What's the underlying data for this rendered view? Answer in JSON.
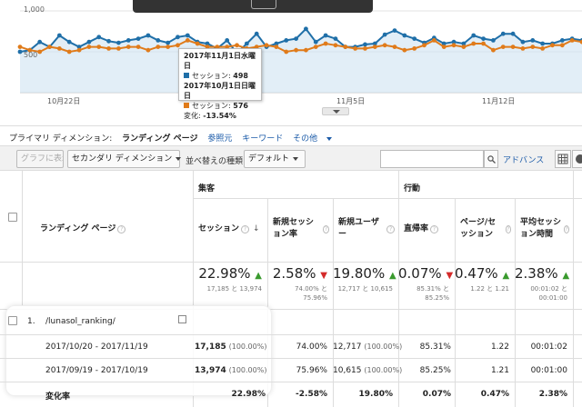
{
  "chart": {
    "y_max_label": "1,000",
    "y_mid_label": "500",
    "x_labels": [
      "10月22日",
      "11月5日",
      "11月12日"
    ],
    "series_colors": {
      "primary": "#1f6fa8",
      "compare": "#e07b1a"
    },
    "tooltip": {
      "date1": "2017年11月1日水曜日",
      "label1": "セッション",
      "value1": "498",
      "date2": "2017年10月1日日曜日",
      "label2": "セッション",
      "value2": "576",
      "change_label": "変化:",
      "change_value": "-13.54%"
    }
  },
  "chart_data": {
    "type": "line",
    "series": [
      {
        "values": [
          500,
          520,
          620,
          560,
          700,
          620,
          560,
          620,
          680,
          630,
          610,
          640,
          660,
          700,
          640,
          610,
          680,
          700,
          620,
          600,
          540,
          640,
          480,
          600,
          720,
          560,
          600,
          640,
          660,
          780,
          620,
          700,
          660,
          560,
          560,
          590,
          600,
          710,
          760,
          700,
          660,
          610,
          670,
          600,
          620,
          600,
          700,
          660,
          640,
          720,
          720,
          620,
          640,
          600,
          600,
          640,
          660,
          640
        ]
      },
      {
        "values": [
          560,
          520,
          500,
          560,
          540,
          500,
          520,
          560,
          560,
          540,
          540,
          560,
          560,
          520,
          560,
          560,
          580,
          640,
          600,
          560,
          560,
          560,
          580,
          540,
          560,
          580,
          560,
          500,
          520,
          520,
          560,
          600,
          580,
          560,
          540,
          540,
          560,
          580,
          560,
          520,
          540,
          580,
          640,
          560,
          580,
          560,
          600,
          600,
          520,
          560,
          560,
          540,
          560,
          540,
          580,
          580,
          640,
          620
        ]
      }
    ],
    "ylim": [
      0,
      1000
    ]
  },
  "dimension_bar": {
    "label": "プライマリ ディメンション:",
    "active": "ランディング ページ",
    "opt1": "参照元",
    "opt2": "キーワード",
    "opt3": "その他"
  },
  "toolbar": {
    "chart_button": "グラフに表示",
    "secondary_dim": "セカンダリ ディメンション",
    "sort_label": "並べ替えの種類:",
    "sort_value": "デフォルト",
    "advanced": "アドバンス"
  },
  "table": {
    "group_acq": "集客",
    "group_behavior": "行動",
    "col_landing": "ランディング ページ",
    "col_sessions": "セッション",
    "col_new_session_rate": "新規セッション率",
    "col_new_users": "新規ユーザー",
    "col_bounce": "直帰率",
    "col_pages": "ページ/セッション",
    "col_duration": "平均セッション時間",
    "summary": {
      "sessions_pct": "22.98%",
      "sessions_sub": "17,185 と 13,974",
      "nsr_pct": "2.58%",
      "nsr_sub1": "74.00% と",
      "nsr_sub2": "75.96%",
      "nu_pct": "19.80%",
      "nu_sub": "12,717 と 10,615",
      "bounce_pct": "0.07%",
      "bounce_sub1": "85.31% と",
      "bounce_sub2": "85.25%",
      "pages_pct": "0.47%",
      "pages_sub": "1.22 と 1.21",
      "dur_pct": "2.38%",
      "dur_sub1": "00:01:02 と",
      "dur_sub2": "00:01:00"
    },
    "row1": {
      "index": "1.",
      "page": "/lunasol_ranking/"
    },
    "row_a": {
      "label": "2017/10/20 - 2017/11/19",
      "sessions": "17,185",
      "sessions_pct": "(100.00%)",
      "nsr": "74.00%",
      "nu": "12,717",
      "nu_pct": "(100.00%)",
      "bounce": "85.31%",
      "pages": "1.22",
      "dur": "00:01:02"
    },
    "row_b": {
      "label": "2017/09/19 - 2017/10/19",
      "sessions": "13,974",
      "sessions_pct": "(100.00%)",
      "nsr": "75.96%",
      "nu": "10,615",
      "nu_pct": "(100.00%)",
      "bounce": "85.25%",
      "pages": "1.21",
      "dur": "00:01:00"
    },
    "row_c": {
      "label": "変化率",
      "sessions": "22.98%",
      "nsr": "-2.58%",
      "nu": "19.80%",
      "bounce": "0.07%",
      "pages": "0.47%",
      "dur": "2.38%"
    }
  }
}
